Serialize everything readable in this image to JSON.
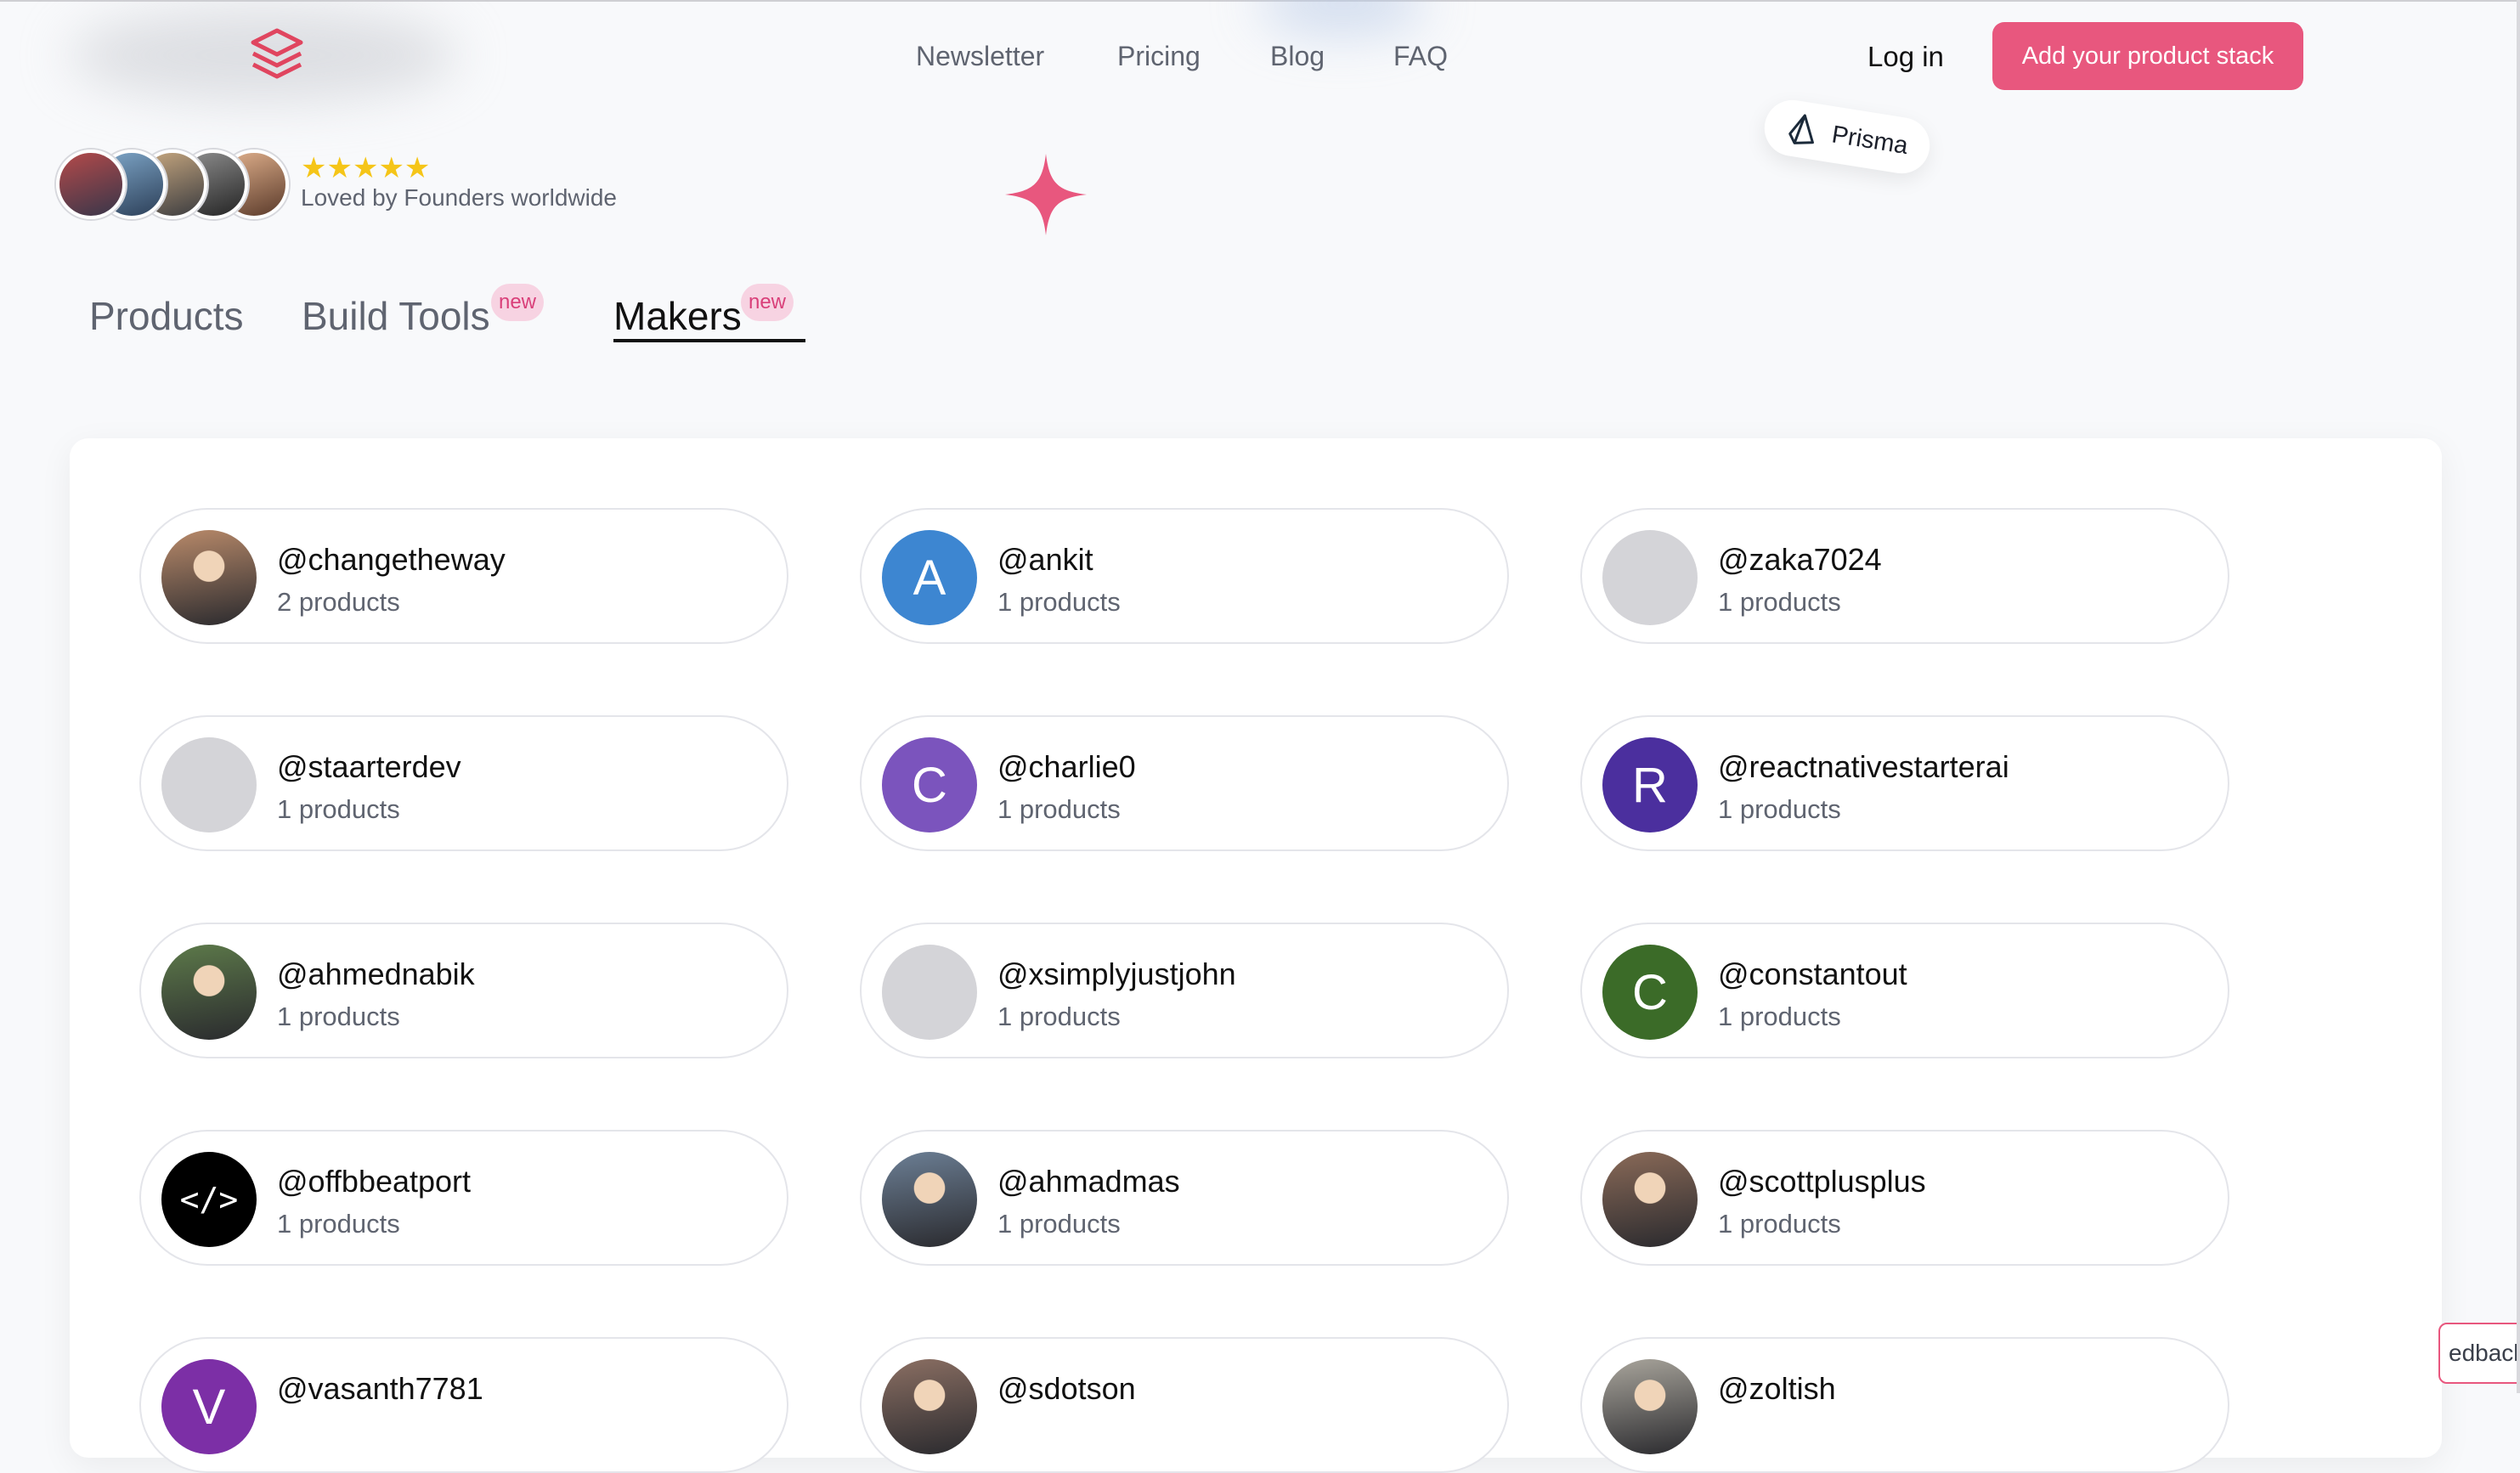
{
  "header": {
    "nav": [
      "Newsletter",
      "Pricing",
      "Blog",
      "FAQ"
    ],
    "login_label": "Log in",
    "cta_label": "Add your product stack",
    "floating_chip": "Prisma"
  },
  "social_proof": {
    "stars": "★★★★★",
    "rating": 5,
    "text": "Loved by Founders worldwide"
  },
  "tabs": [
    {
      "label": "Products",
      "active": false,
      "badge": ""
    },
    {
      "label": "Build Tools",
      "active": false,
      "badge": "new"
    },
    {
      "label": "Makers",
      "active": true,
      "badge": "new"
    }
  ],
  "makers": [
    {
      "handle": "@changetheway",
      "count": "2 products",
      "avatar": "photo",
      "initial": "",
      "color": "#b98a6a"
    },
    {
      "handle": "@ankit",
      "count": "1 products",
      "avatar": "letter",
      "initial": "A",
      "color": "#3d86d1"
    },
    {
      "handle": "@zaka7024",
      "count": "1 products",
      "avatar": "blank",
      "initial": "",
      "color": "#d4d4d8"
    },
    {
      "handle": "@staarterdev",
      "count": "1 products",
      "avatar": "blank",
      "initial": "",
      "color": "#d4d4d8"
    },
    {
      "handle": "@charlie0",
      "count": "1 products",
      "avatar": "letter",
      "initial": "C",
      "color": "#7b54bd"
    },
    {
      "handle": "@reactnativestarterai",
      "count": "1 products",
      "avatar": "letter",
      "initial": "R",
      "color": "#4b2f9e"
    },
    {
      "handle": "@ahmednabik",
      "count": "1 products",
      "avatar": "photo",
      "initial": "",
      "color": "#5d7a4a"
    },
    {
      "handle": "@xsimplyjustjohn",
      "count": "1 products",
      "avatar": "blank",
      "initial": "",
      "color": "#d4d4d8"
    },
    {
      "handle": "@constantout",
      "count": "1 products",
      "avatar": "letter",
      "initial": "C",
      "color": "#3b6b28"
    },
    {
      "handle": "@offbbeatport",
      "count": "1 products",
      "avatar": "code",
      "initial": "</>",
      "color": "#000000"
    },
    {
      "handle": "@ahmadmas",
      "count": "1 products",
      "avatar": "photo",
      "initial": "",
      "color": "#6c7f95"
    },
    {
      "handle": "@scottplusplus",
      "count": "1 products",
      "avatar": "photo",
      "initial": "",
      "color": "#8a6a58"
    },
    {
      "handle": "@vasanth7781",
      "count": "",
      "avatar": "letter",
      "initial": "V",
      "color": "#7c2fa6"
    },
    {
      "handle": "@sdotson",
      "count": "",
      "avatar": "photo",
      "initial": "",
      "color": "#8b6f63"
    },
    {
      "handle": "@zoltish",
      "count": "",
      "avatar": "photo",
      "initial": "",
      "color": "#a9a59c"
    }
  ],
  "feedback_label": "edback",
  "colors": {
    "accent": "#e8577e",
    "badge_bg": "#f7d3e2",
    "star": "#f5c518"
  }
}
